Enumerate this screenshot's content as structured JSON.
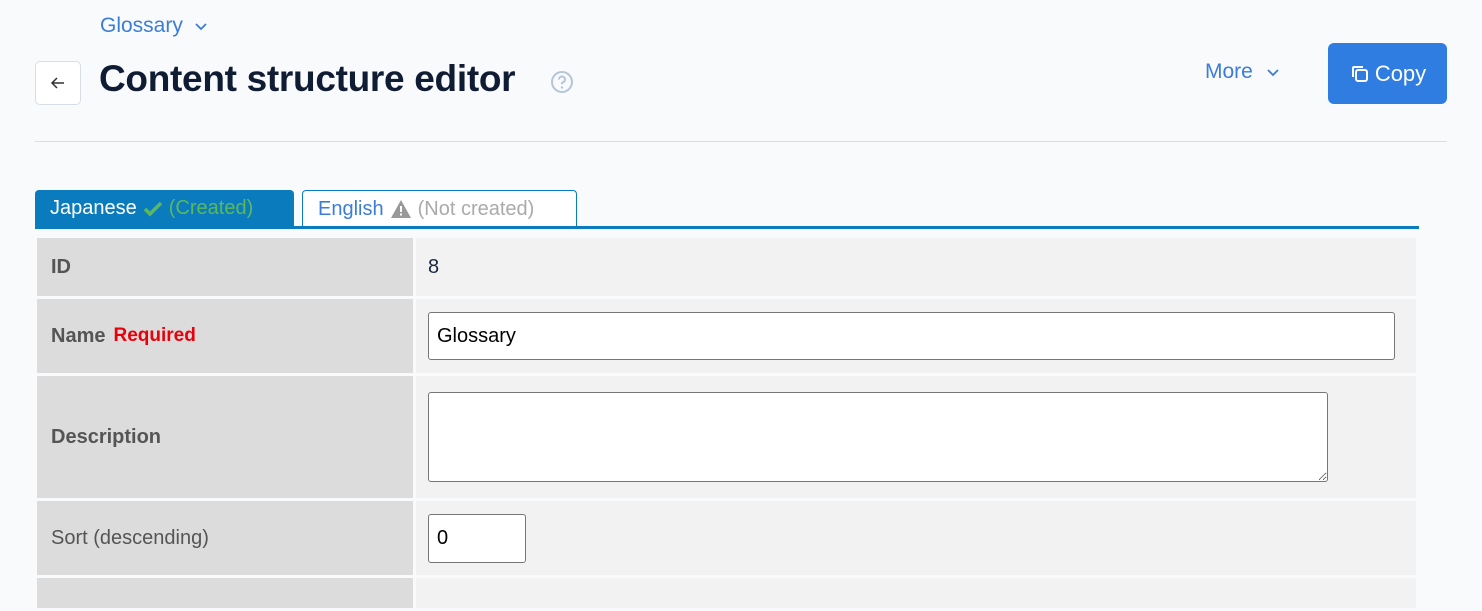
{
  "breadcrumb": {
    "label": "Glossary"
  },
  "header": {
    "title": "Content structure editor",
    "more_label": "More",
    "copy_label": "Copy"
  },
  "tabs": [
    {
      "label": "Japanese",
      "status": "(Created)",
      "icon": "check-icon",
      "active": true
    },
    {
      "label": "English",
      "status": "(Not created)",
      "icon": "warning-icon",
      "active": false
    }
  ],
  "form": {
    "id": {
      "label": "ID",
      "value": "8"
    },
    "name": {
      "label": "Name",
      "required": "Required",
      "value": "Glossary"
    },
    "description": {
      "label": "Description",
      "value": ""
    },
    "sort": {
      "label": "Sort (descending)",
      "value": "0"
    }
  },
  "colors": {
    "accent": "#2f7de1",
    "tab_active": "#0a7bbd",
    "required": "#e8000b",
    "created": "#5cb85c"
  }
}
